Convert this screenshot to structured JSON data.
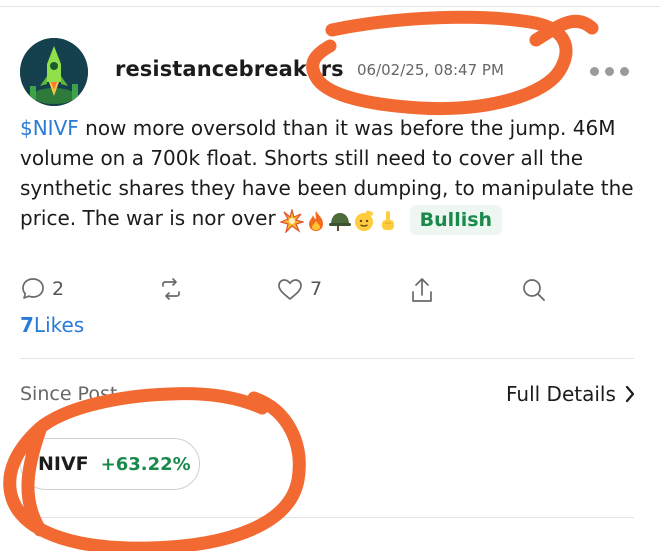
{
  "post": {
    "username": "resistancebreakers",
    "timestamp": "06/02/25, 08:47 PM",
    "ticker": "$NIVF",
    "text": " now more oversold than it was before the jump. 46M volume on a 700k float. Shorts still need to cover all the synthetic shares they have been dumping, to manipulate the price. The war is nor over",
    "emojis": [
      "collision",
      "fire",
      "military-helmet",
      "saluting-face",
      "index-pointing-up"
    ],
    "sentiment": "Bullish"
  },
  "actions": {
    "comments_count": "2",
    "likes_count": "7"
  },
  "likes_summary": {
    "count": "7",
    "label": "Likes"
  },
  "since_post": {
    "label": "Since Post",
    "full_details_label": "Full Details"
  },
  "ticker_chip": {
    "symbol": "NIVF",
    "change": "+63.22%"
  },
  "colors": {
    "link_blue": "#2a7bd6",
    "bullish_green": "#1a8a4c",
    "annotation_orange": "#f26a32"
  }
}
